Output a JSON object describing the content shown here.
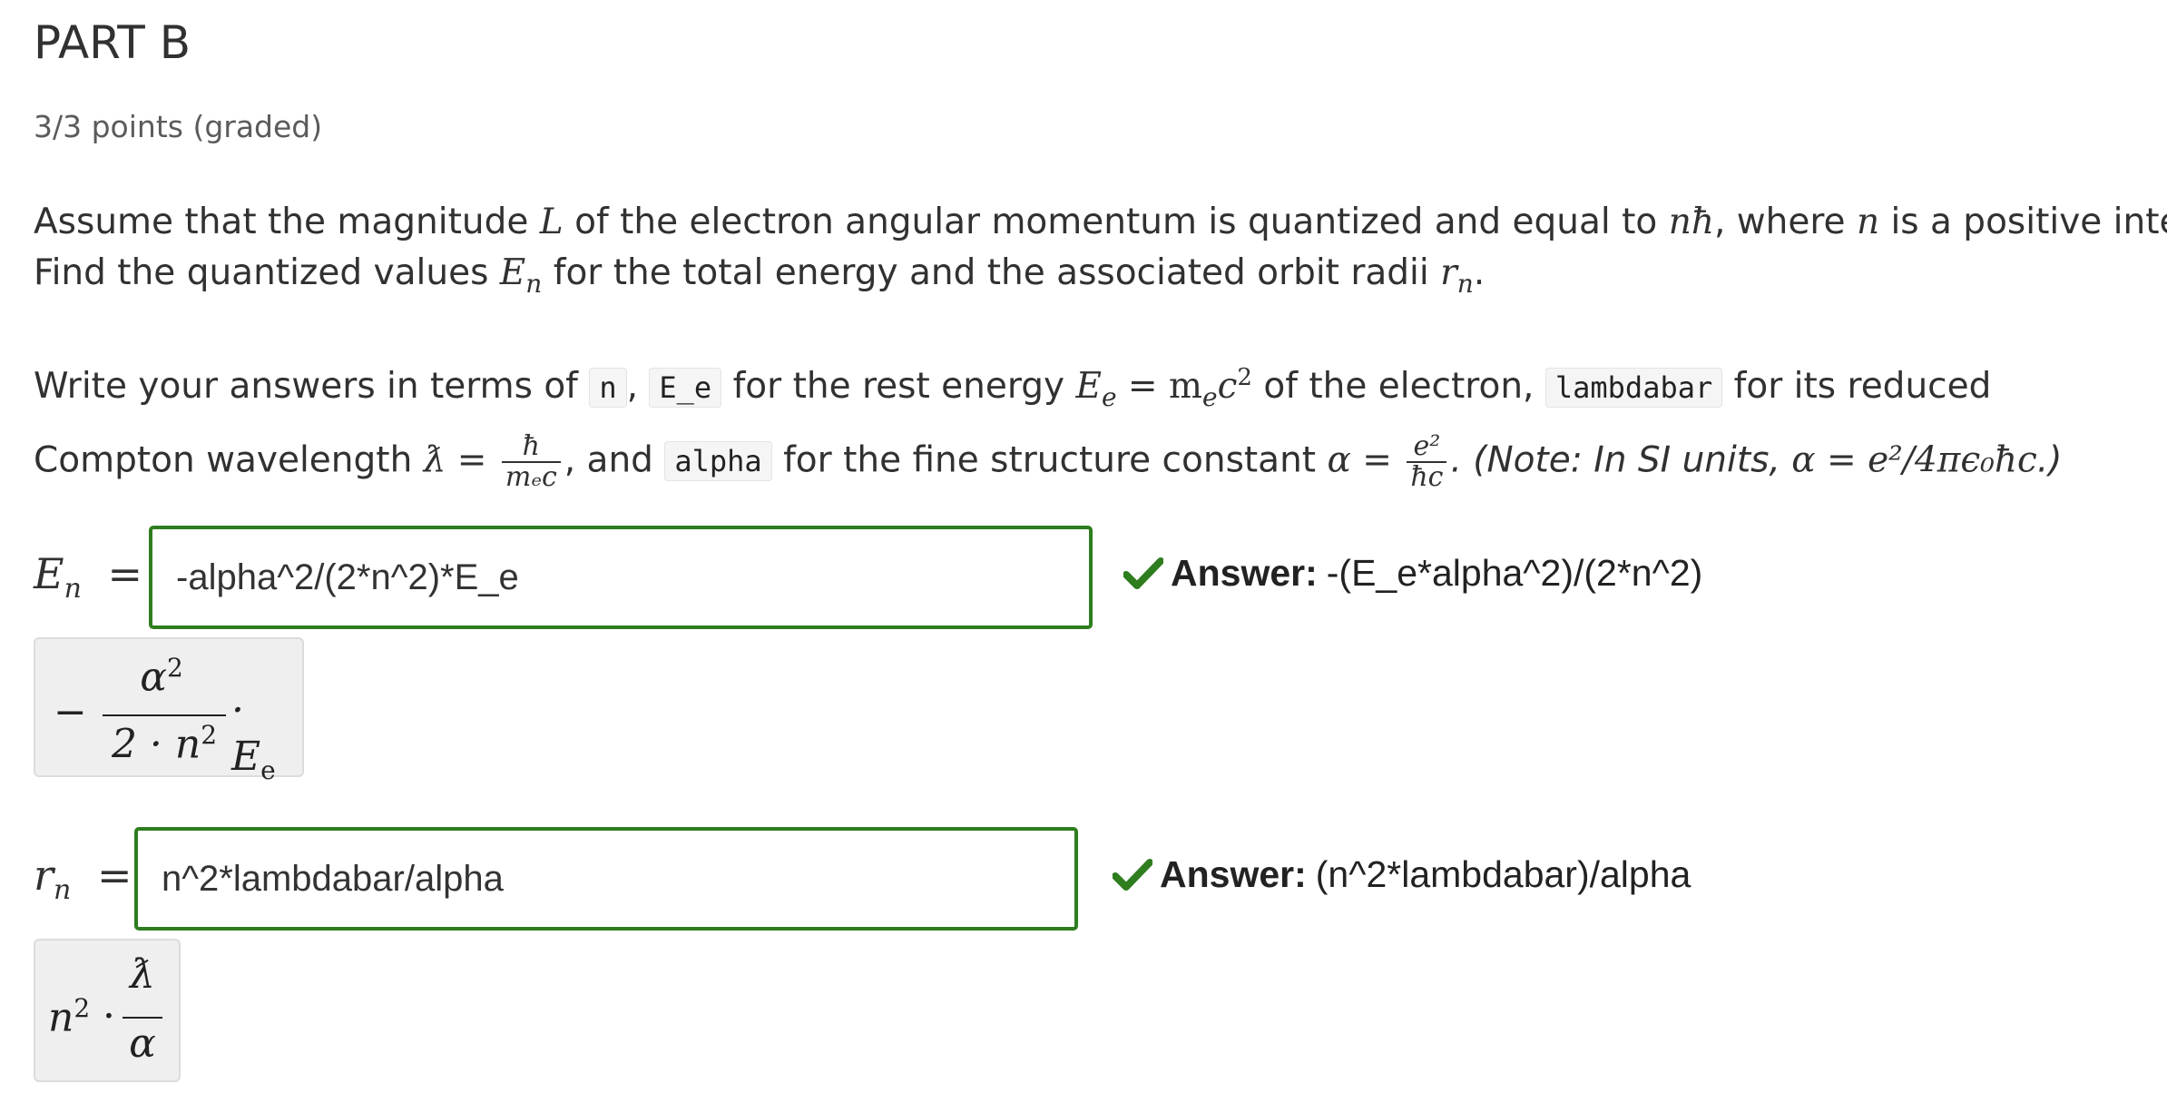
{
  "title": "PART B",
  "points": "3/3 points (graded)",
  "problem": {
    "p1_a": "Assume that the magnitude ",
    "p1_L": "L",
    "p1_b": " of the electron angular momentum is quantized and equal to ",
    "p1_nhbar": "nħ",
    "p1_c": ", where ",
    "p1_n": "n",
    "p1_d": " is a positive integer.",
    "p2_a": "Find the quantized values ",
    "p2_E": "E",
    "p2_Esub": "n",
    "p2_b": " for the total energy and the associated orbit radii ",
    "p2_r": "r",
    "p2_rsub": "n",
    "p2_c": "."
  },
  "instructions": {
    "a": "Write your answers in terms of ",
    "code_n": "n",
    "sep": ", ",
    "code_Ee": "E_e",
    "b": " for the rest energy ",
    "Ee_eq": "E",
    "Ee_sub": "e",
    "Ee_rhs": " = m",
    "Ee_rhs_sub": "e",
    "Ee_rhs_c": "c",
    "Ee_rhs_sup": "2",
    "c": " of the electron, ",
    "code_lambdabar": "lambdabar",
    "d": " for its reduced",
    "e": "Compton wavelength ",
    "lambdabar_sym": "ƛ",
    "eq": " = ",
    "frac1_num": "ħ",
    "frac1_den": "mₑc",
    "f": ", and ",
    "code_alpha": "alpha",
    "g": " for the fine structure constant ",
    "alpha_sym": "α",
    "frac2_num": "e²",
    "frac2_den": "ħc",
    "note": ". (Note: In SI units, ",
    "note_math": "α = e²/4πϵ₀ħc",
    "note_end": ".)"
  },
  "answers": [
    {
      "label_var": "E",
      "label_sub": "n",
      "label_eq": "=",
      "input_value": "-alpha^2/(2*n^2)*E_e",
      "status": "correct",
      "answer_label": "Answer:",
      "answer_value": "-(E_e*alpha^2)/(2*n^2)",
      "preview": {
        "sign": "−",
        "num": "α",
        "num_sup": "2",
        "den": "2 · n",
        "den_sup": "2",
        "tail": "· E",
        "tail_sub": "e"
      }
    },
    {
      "label_var": "r",
      "label_sub": "n",
      "label_eq": "=",
      "input_value": "n^2*lambdabar/alpha",
      "status": "correct",
      "answer_label": "Answer:",
      "answer_value": "(n^2*lambdabar)/alpha",
      "preview": {
        "lead": "n",
        "lead_sup": "2",
        "dot": "·",
        "num": "ƛ",
        "den": "α"
      }
    }
  ],
  "colors": {
    "correct_border": "#2e7d1f",
    "check": "#2e7d1f",
    "preview_bg": "#efefef"
  },
  "icons": {
    "check": "checkmark-icon"
  }
}
